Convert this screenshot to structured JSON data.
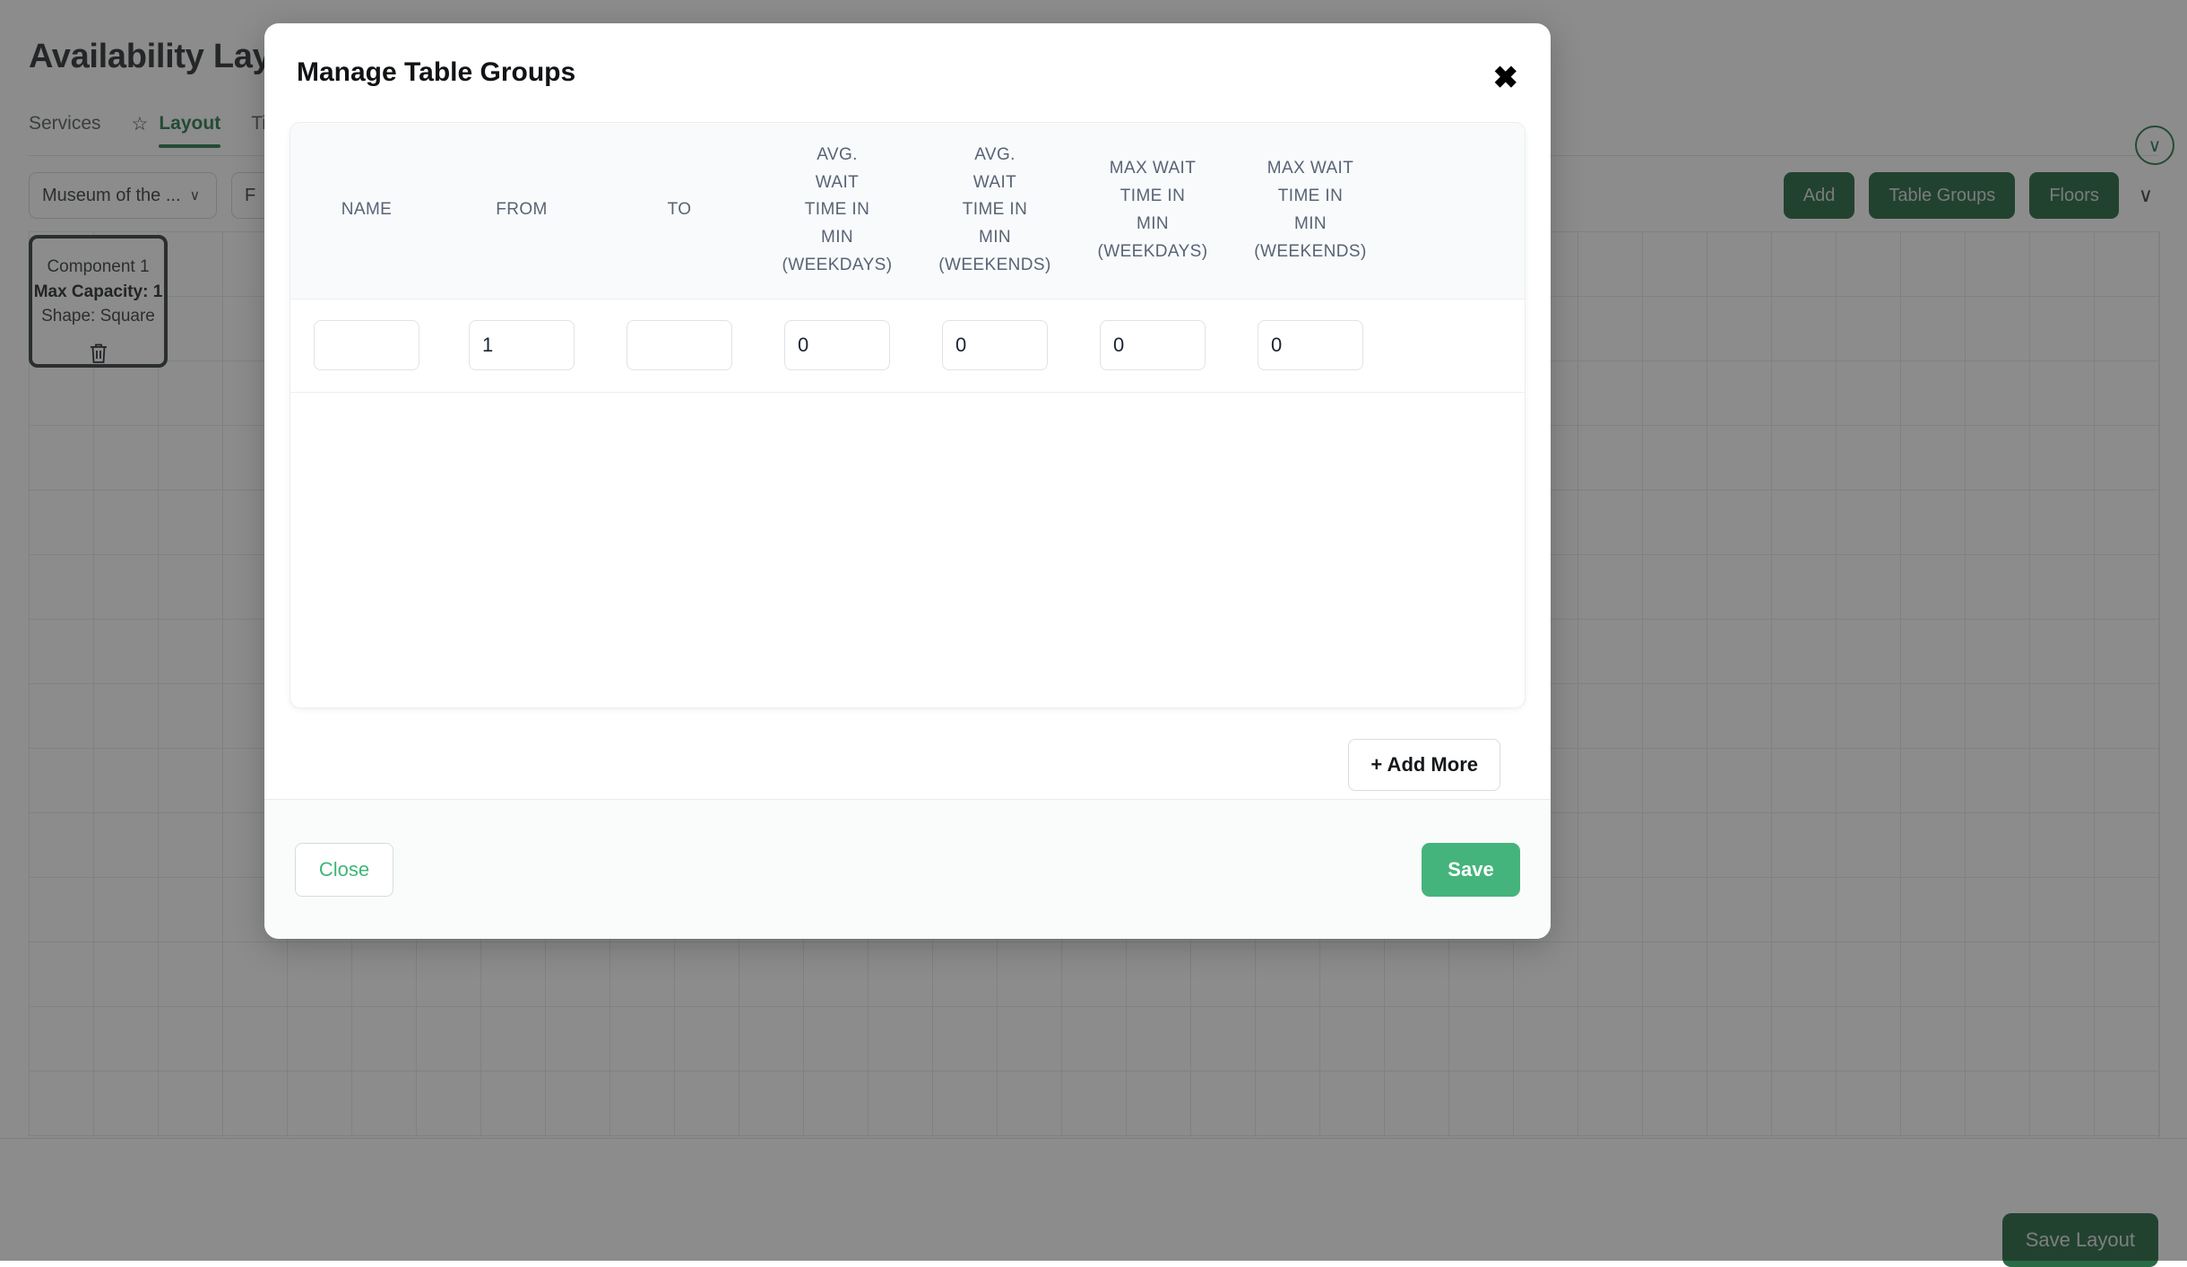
{
  "page": {
    "title": "Availability Layout",
    "tabs": [
      {
        "label": "Services",
        "active": false
      },
      {
        "label": "Layout",
        "active": true
      },
      {
        "label": "Ti",
        "active": false
      }
    ],
    "star_icon": "☆",
    "selects": {
      "venue_value": "Museum of the ...",
      "floor_value": "F",
      "chevron": "∨"
    },
    "actions": {
      "add": "Add",
      "table_groups": "Table Groups",
      "floors": "Floors",
      "overflow_chevron": "∨"
    },
    "collapse_chevron": "∨",
    "component": {
      "title": "Component 1",
      "max_capacity": "Max Capacity: 1",
      "shape": "Shape: Square"
    },
    "save_layout": "Save Layout"
  },
  "modal": {
    "title": "Manage Table Groups",
    "close_icon": "✖",
    "table": {
      "columns": [
        {
          "key": "name",
          "lines": [
            "NAME"
          ]
        },
        {
          "key": "from",
          "lines": [
            "FROM"
          ]
        },
        {
          "key": "to",
          "lines": [
            "TO"
          ]
        },
        {
          "key": "avg_wait_weekdays",
          "lines": [
            "AVG.",
            "WAIT",
            "TIME IN",
            "MIN",
            "(WEEKDAYS)"
          ]
        },
        {
          "key": "avg_wait_weekends",
          "lines": [
            "AVG.",
            "WAIT",
            "TIME IN",
            "MIN",
            "(WEEKENDS)"
          ]
        },
        {
          "key": "max_wait_weekdays",
          "lines": [
            "MAX WAIT",
            "TIME IN",
            "MIN",
            "(WEEKDAYS)"
          ]
        },
        {
          "key": "max_wait_weekends",
          "lines": [
            "MAX WAIT",
            "TIME IN",
            "MIN",
            "(WEEKENDS)"
          ]
        }
      ],
      "rows": [
        {
          "name": "",
          "from": "1",
          "to": "",
          "avg_wait_weekdays": "0",
          "avg_wait_weekends": "0",
          "max_wait_weekdays": "0",
          "max_wait_weekends": "0"
        }
      ]
    },
    "add_more": "+ Add More",
    "close_button": "Close",
    "save_button": "Save"
  },
  "colors": {
    "brand_green": "#2a6b46",
    "accent_green": "#45b47c",
    "tab_active": "#2f7a4e",
    "header_text": "#596375",
    "overlay": "rgba(25,25,25,0.50)"
  }
}
